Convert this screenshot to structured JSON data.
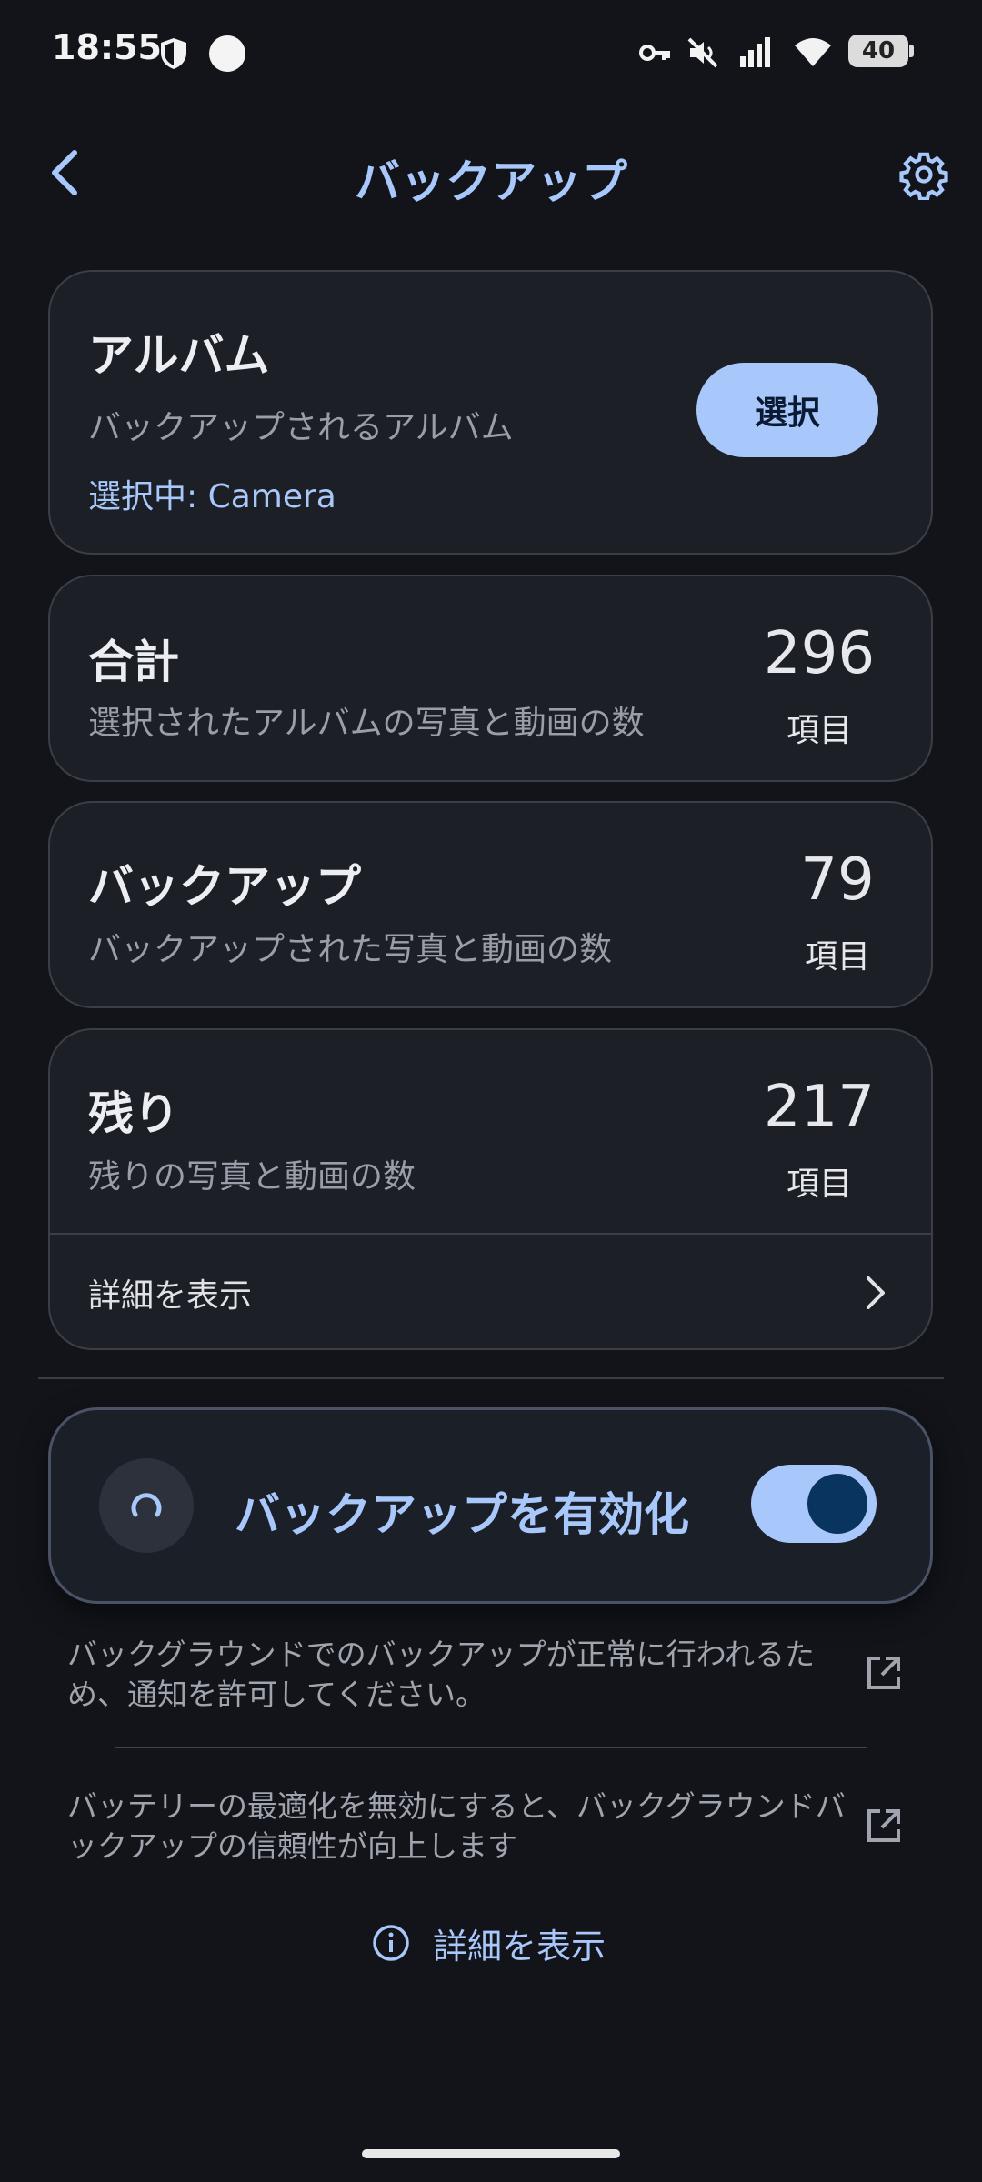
{
  "status_bar": {
    "time": "18:55",
    "battery": "40"
  },
  "header": {
    "title": "バックアップ"
  },
  "album_card": {
    "title": "アルバム",
    "subtitle": "バックアップされるアルバム",
    "selected": "選択中: Camera",
    "select_button": "選択"
  },
  "total_card": {
    "title": "合計",
    "subtitle": "選択されたアルバムの写真と動画の数",
    "count": "296",
    "unit": "項目"
  },
  "backup_card": {
    "title": "バックアップ",
    "subtitle": "バックアップされた写真と動画の数",
    "count": "79",
    "unit": "項目"
  },
  "remaining_card": {
    "title": "残り",
    "subtitle": "残りの写真と動画の数",
    "count": "217",
    "unit": "項目",
    "details_label": "詳細を表示"
  },
  "enable_backup": {
    "label": "バックアップを有効化",
    "enabled": true
  },
  "notes": [
    {
      "text": "バックグラウンドでのバックアップが正常に行われるため、通知を許可してください。"
    },
    {
      "text": "バッテリーの最適化を無効にすると、バックグラウンドバックアップの信頼性が向上します"
    }
  ],
  "footer": {
    "details_link": "詳細を表示"
  },
  "colors": {
    "accent": "#a8c7fa",
    "background": "#12141a",
    "card": "#1c1f26"
  }
}
